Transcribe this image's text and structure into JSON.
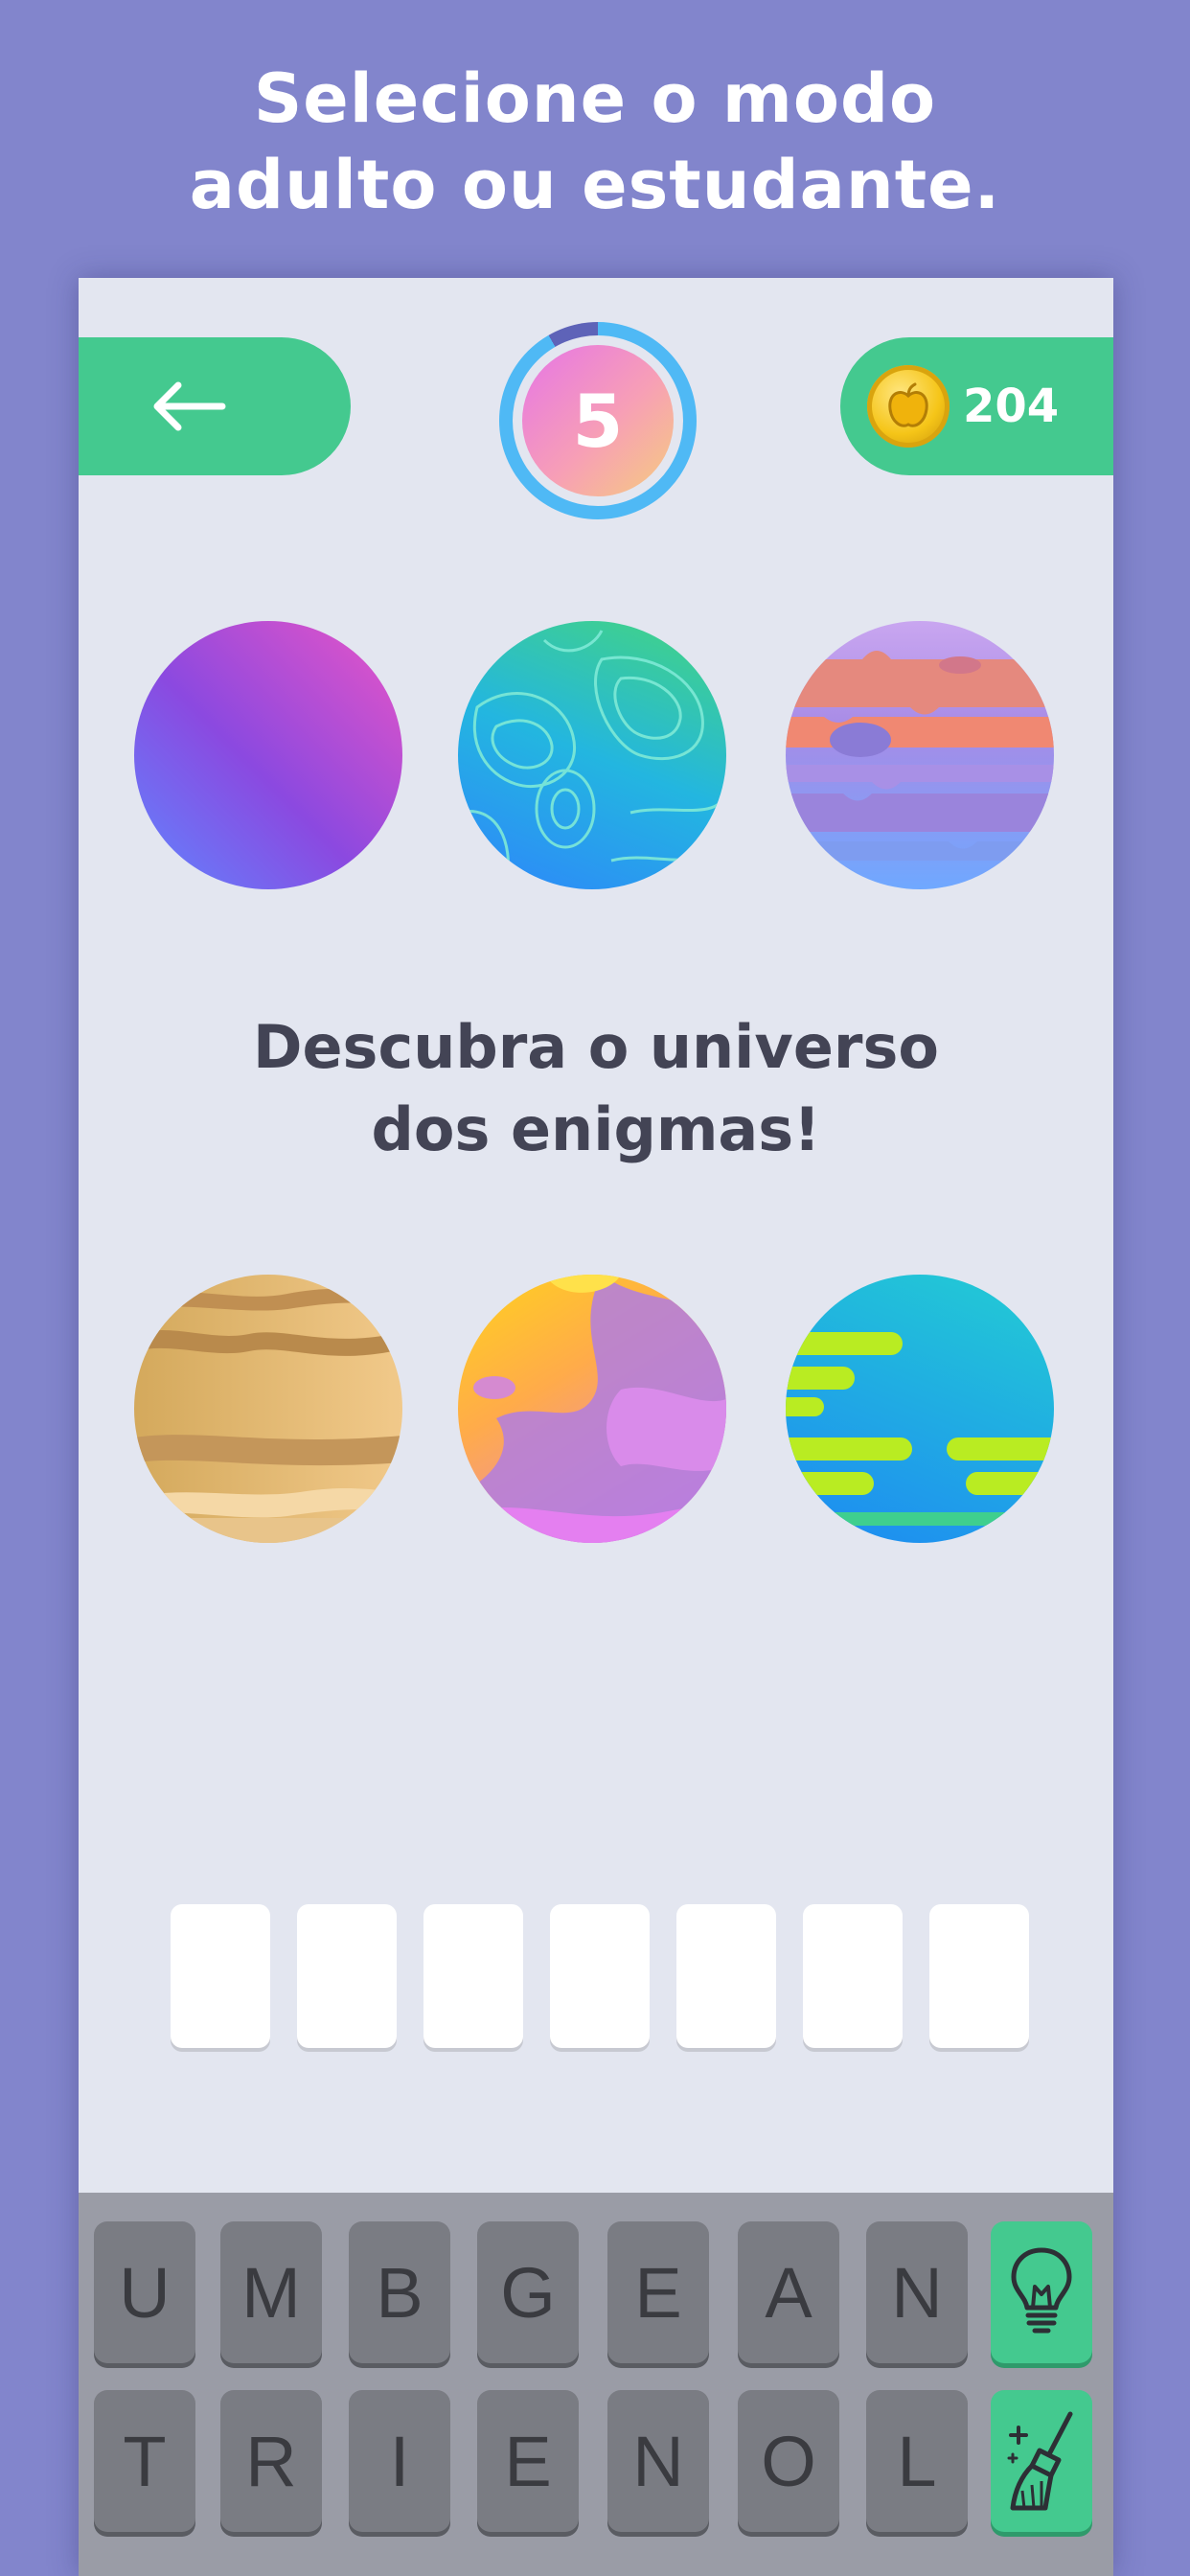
{
  "headline": {
    "line1": "Selecione o modo",
    "line2": "adulto ou estudante."
  },
  "header": {
    "back_icon": "arrow-left-icon",
    "level": "5",
    "level_progress": 0.92,
    "coins": "204",
    "coin_icon": "apple-coin-icon"
  },
  "tagline": {
    "line1": "Descubra o universo",
    "line2": "dos enigmas!"
  },
  "answer": {
    "slot_count": 7
  },
  "keyboard": {
    "row1": [
      "U",
      "M",
      "B",
      "G",
      "E",
      "A",
      "N"
    ],
    "row2": [
      "T",
      "R",
      "I",
      "E",
      "N",
      "O",
      "L"
    ],
    "hint_icon": "lightbulb-icon",
    "clear_icon": "broom-icon"
  },
  "colors": {
    "background": "#8285cc",
    "accent_green": "#44c98f",
    "panel": "#e3e6f0",
    "text_dark": "#434455"
  }
}
